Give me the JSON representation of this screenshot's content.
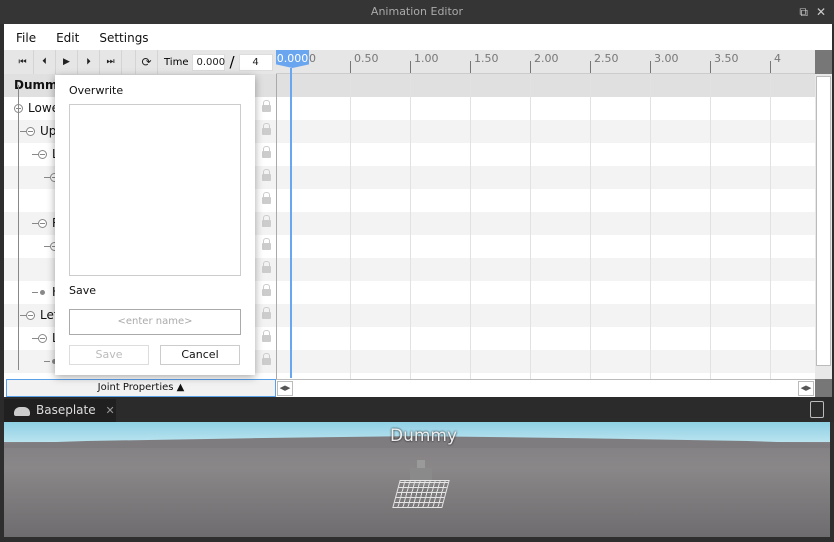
{
  "window": {
    "title": "Animation Editor"
  },
  "menu": [
    "File",
    "Edit",
    "Settings"
  ],
  "toolbar": {
    "time_label": "Time",
    "current_time": "0.000",
    "separator": "/",
    "length": "4",
    "marker": "0.000"
  },
  "ruler_ticks": [
    "0",
    "0.50",
    "1.00",
    "1.50",
    "2.00",
    "2.50",
    "3.00",
    "3.50",
    "4"
  ],
  "tree": {
    "root": "Dummy",
    "rows": [
      {
        "label": "Lowe",
        "depth": 0,
        "node": "circle"
      },
      {
        "label": "Up",
        "depth": 1,
        "node": "circle"
      },
      {
        "label": "L",
        "depth": 2,
        "node": "circle"
      },
      {
        "label": "",
        "depth": 3,
        "node": "circle"
      },
      {
        "label": "",
        "depth": 4,
        "node": "none"
      },
      {
        "label": "R",
        "depth": 2,
        "node": "circle"
      },
      {
        "label": "",
        "depth": 3,
        "node": "circle"
      },
      {
        "label": "",
        "depth": 4,
        "node": "none"
      },
      {
        "label": "H",
        "depth": 2,
        "node": "dot"
      },
      {
        "label": "Lef",
        "depth": 1,
        "node": "circle"
      },
      {
        "label": "L",
        "depth": 2,
        "node": "circle"
      },
      {
        "label": "",
        "depth": 3,
        "node": "dot"
      }
    ]
  },
  "joint_properties": "Joint Properties ▲",
  "popup": {
    "overwrite": "Overwrite",
    "save_heading": "Save",
    "name_placeholder": "<enter name>",
    "save_button": "Save",
    "cancel_button": "Cancel"
  },
  "viewport": {
    "tab": "Baseplate",
    "tab_close": "✕",
    "model_label": "Dummy"
  },
  "colors": {
    "accent": "#6aa6f0",
    "titlebar": "#353535"
  }
}
